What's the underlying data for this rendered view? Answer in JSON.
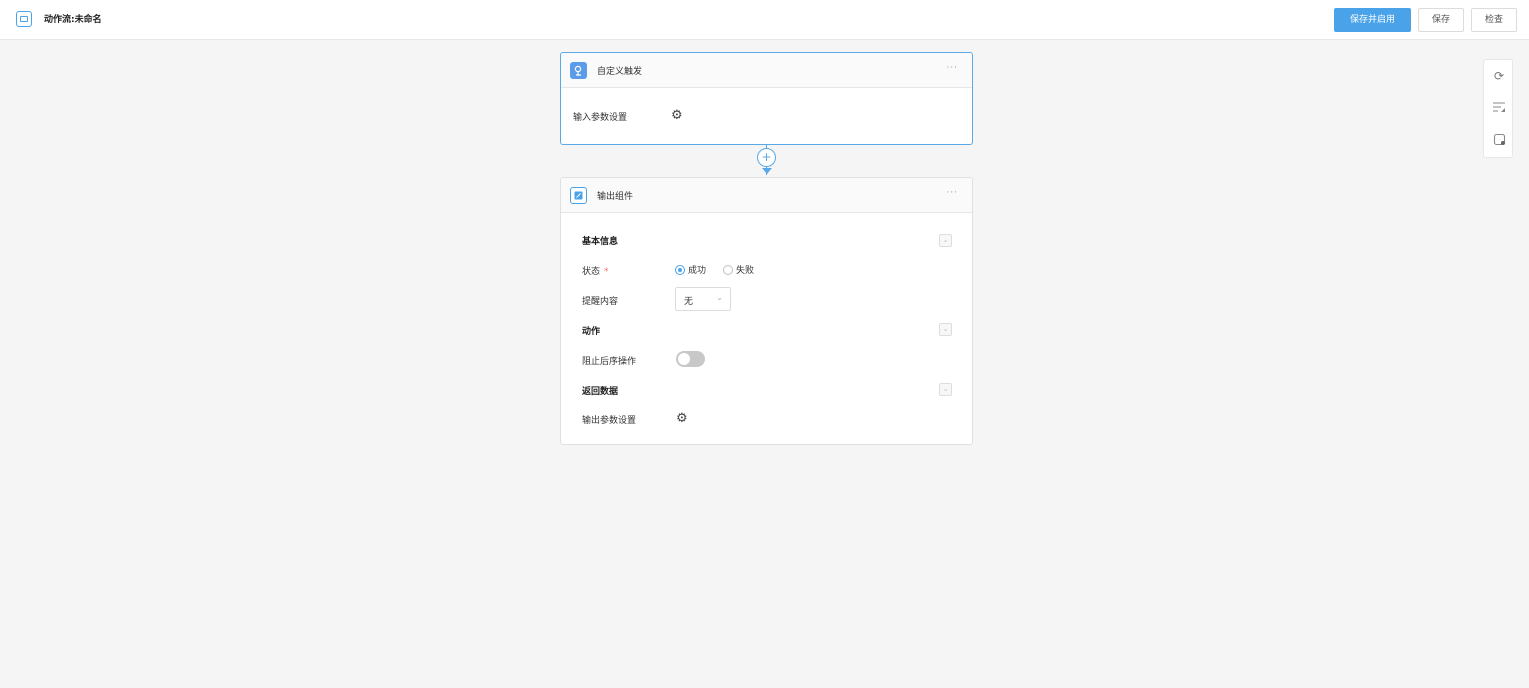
{
  "header": {
    "title": "动作流:未命名",
    "buttons": {
      "save_enable": "保存并启用",
      "save": "保存",
      "check": "检查"
    }
  },
  "trigger_node": {
    "title": "自定义触发",
    "more": "···",
    "input_params_label": "输入参数设置"
  },
  "connector": {
    "add": "+"
  },
  "output_node": {
    "title": "输出组件",
    "more": "···",
    "sections": {
      "basic": "基本信息",
      "action": "动作",
      "return": "返回数据"
    },
    "status": {
      "label": "状态",
      "required_mark": "*",
      "options": [
        "成功",
        "失败"
      ],
      "selected": "成功"
    },
    "reminder": {
      "label": "提醒内容",
      "value": "无"
    },
    "stop_subsequent": {
      "label": "阻止后序操作",
      "enabled": false
    },
    "output_params_label": "输出参数设置"
  },
  "colors": {
    "accent": "#4aa3e8",
    "required": "#f56c6c"
  },
  "icons": {
    "app": "workflow-icon",
    "trigger": "trigger-icon",
    "output": "output-icon",
    "gear": "gear-icon",
    "refresh": "refresh-icon",
    "layout": "layout-icon",
    "fit": "fit-view-icon"
  }
}
